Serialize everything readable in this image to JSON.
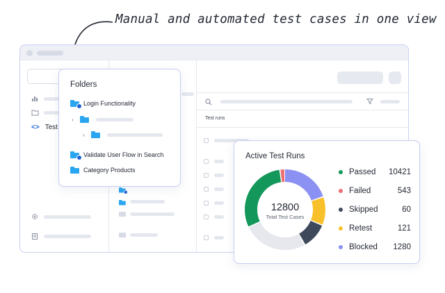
{
  "headline": "Manual and automated test cases in one view",
  "sidebar": {
    "active_item": {
      "label": "Test",
      "icon": "code-icon"
    }
  },
  "runs_table": {
    "header": "Test runs"
  },
  "folders_popup": {
    "title": "Folders",
    "items": [
      {
        "label": "Login Functionality",
        "icon": "folder-gear-icon"
      },
      {
        "label": "",
        "icon": "folder-icon",
        "collapsed": true
      },
      {
        "label": "",
        "icon": "folder-icon",
        "collapsed": true
      },
      {
        "label": "Validate User Flow in Search",
        "icon": "folder-gear-icon"
      },
      {
        "label": "Category Products",
        "icon": "folder-icon"
      }
    ]
  },
  "active_runs": {
    "title": "Active Test Runs",
    "total_value": "12800",
    "total_label": "Total Test Cases",
    "legend": [
      {
        "label": "Passed",
        "value": "10421",
        "color": "#14975a"
      },
      {
        "label": "Failed",
        "value": "543",
        "color": "#f06e72"
      },
      {
        "label": "Skipped",
        "value": "60",
        "color": "#3e4a5c"
      },
      {
        "label": "Retest",
        "value": "121",
        "color": "#f8c02a"
      },
      {
        "label": "Blocked",
        "value": "1280",
        "color": "#8b90f3"
      }
    ]
  },
  "donut_segments": [
    {
      "name": "blocked",
      "fraction": 0.2,
      "color": "#8b90f3"
    },
    {
      "name": "retest",
      "fraction": 0.115,
      "color": "#f8c02a"
    },
    {
      "name": "skipped",
      "fraction": 0.105,
      "color": "#3e4a5c"
    },
    {
      "name": "remaining",
      "fraction": 0.26,
      "color": "#e6e8ee"
    },
    {
      "name": "passed",
      "fraction": 0.3,
      "color": "#14975a"
    },
    {
      "name": "failed",
      "fraction": 0.02,
      "color": "#f06e72"
    }
  ]
}
